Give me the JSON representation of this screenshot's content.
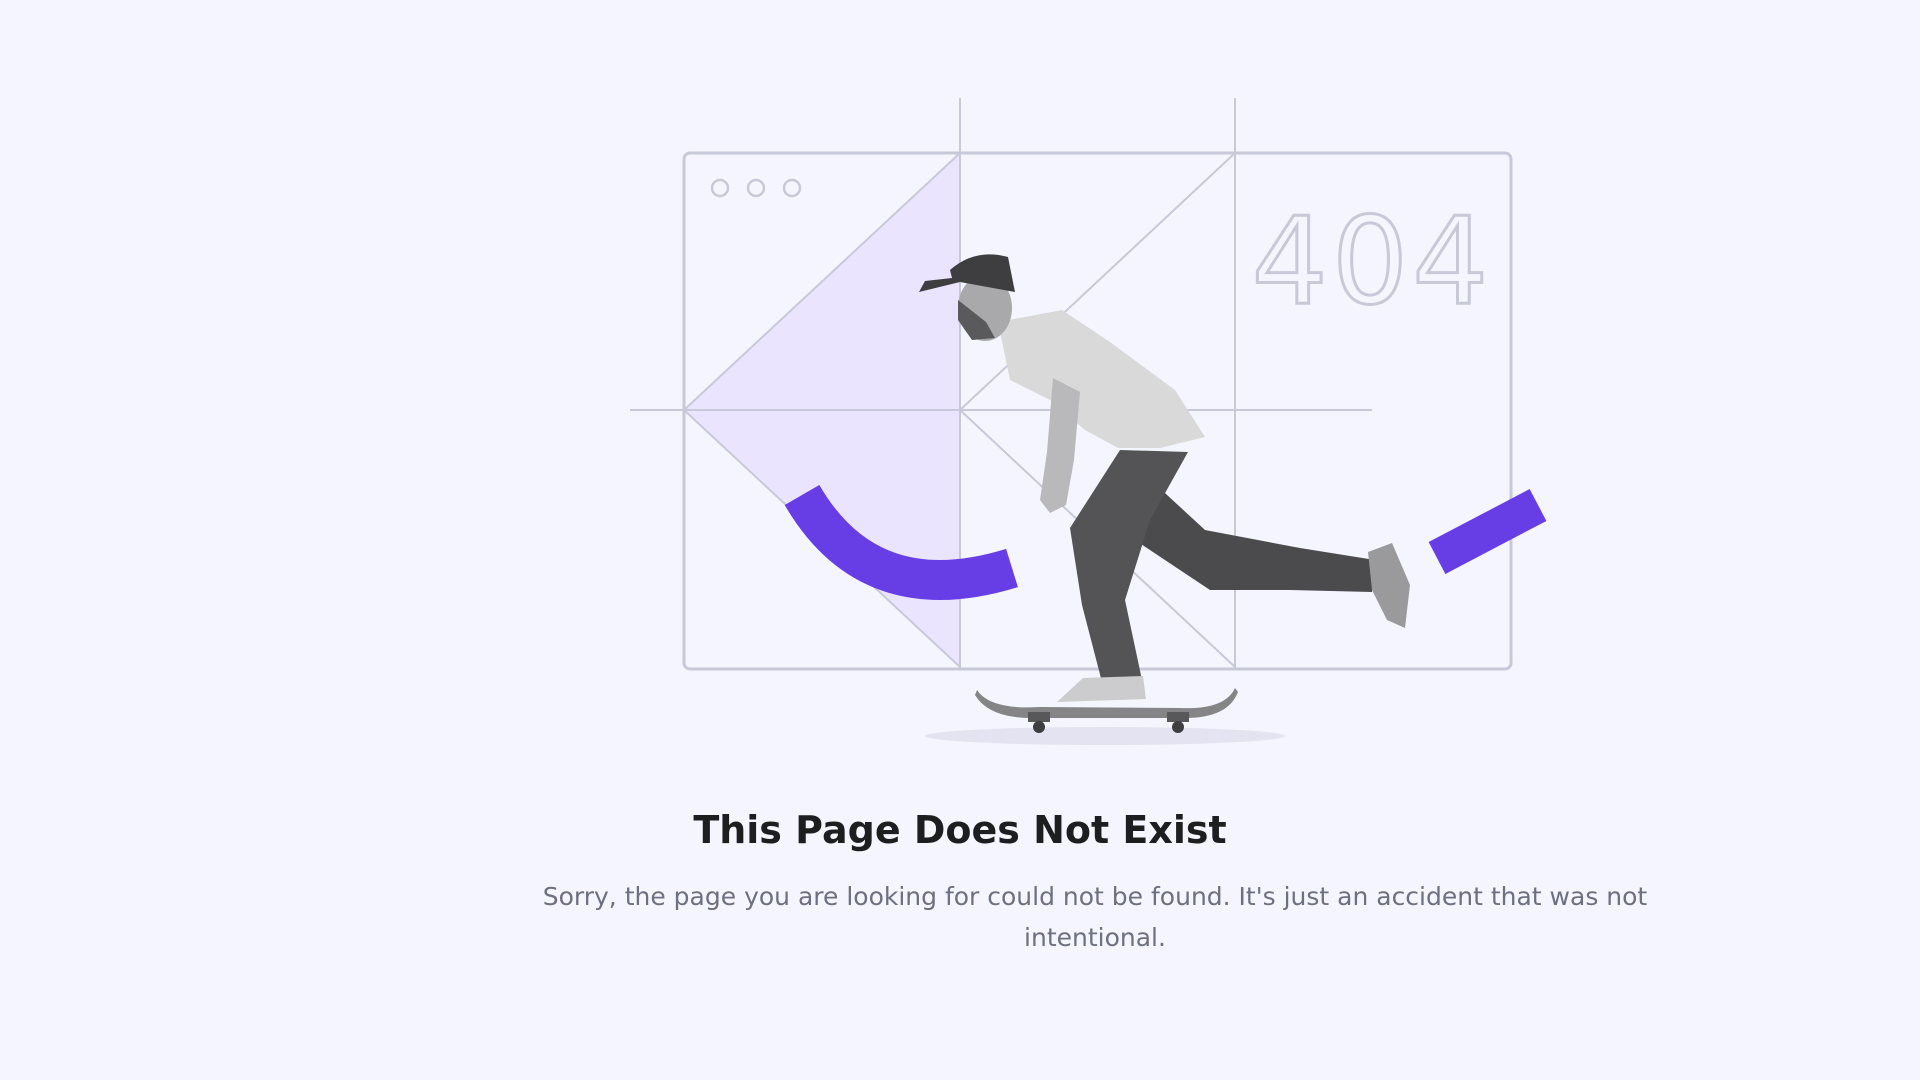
{
  "error": {
    "code": "404",
    "title": "This Page Does Not Exist",
    "message": "Sorry, the page you are looking for could not be found. It's just an accident that was not intentional."
  },
  "illustration": {
    "subject": "skateboarder",
    "window_controls": [
      "circle",
      "circle",
      "circle"
    ]
  },
  "colors": {
    "background": "#F4F5FF",
    "accent": "#673DE6",
    "accent_light": "#EBE4FF",
    "line": "#C7C9D9",
    "title": "#1D1E20",
    "message": "#6D7081"
  }
}
